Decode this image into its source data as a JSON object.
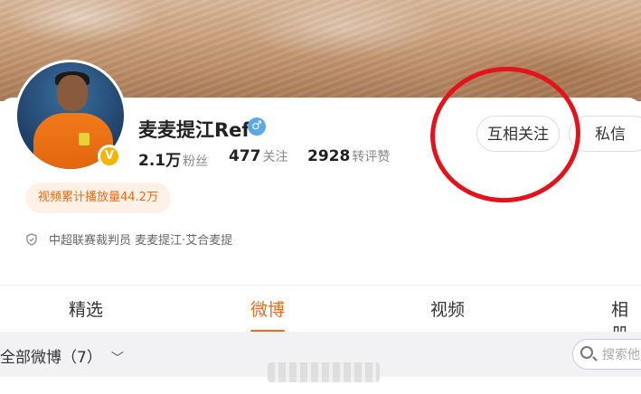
{
  "profile": {
    "name": "麦麦提江Ref",
    "gender_icon": "male-icon",
    "verified_badge": "V",
    "stats": [
      {
        "value": "2.1万",
        "label": "粉丝"
      },
      {
        "value": "477",
        "label": "关注"
      },
      {
        "value": "2928",
        "label": "转评赞"
      }
    ],
    "video_tag": "视频累计播放量44.2万",
    "description": "中超联赛裁判员 麦麦提江·艾合麦提"
  },
  "actions": {
    "follow_label": "互相关注",
    "message_label": "私信"
  },
  "tabs": [
    "精选",
    "微博",
    "视频",
    "相册"
  ],
  "active_tab": "微博",
  "filter": {
    "label": "全部微博（7）",
    "search_placeholder": "搜索他"
  },
  "colors": {
    "accent": "#f06a1a",
    "annotation_circle": "#e5121b",
    "verified": "#f5b400"
  }
}
